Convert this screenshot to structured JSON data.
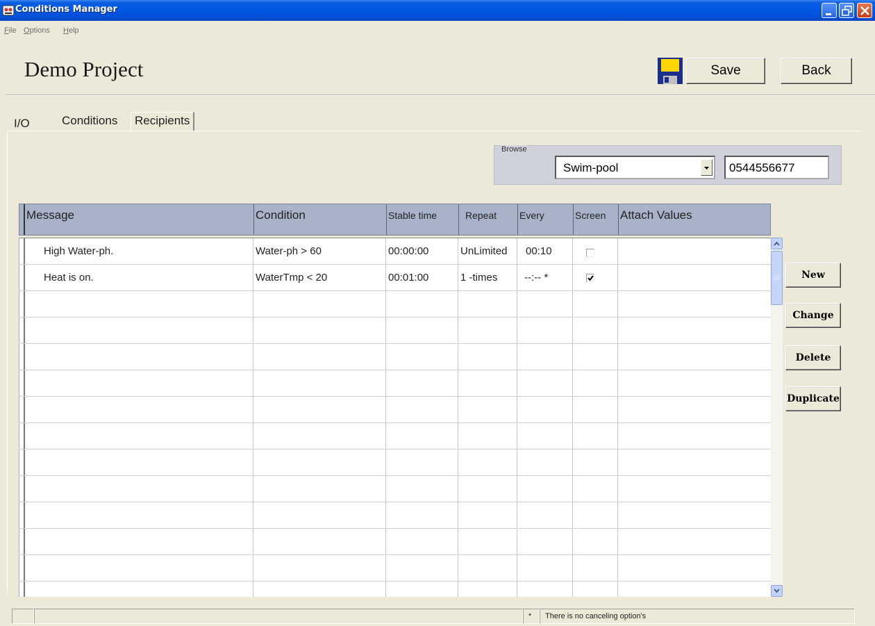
{
  "window": {
    "title": "Conditions Manager"
  },
  "menu": [
    "File",
    "Options",
    "Help"
  ],
  "header": {
    "project_title": "Demo Project",
    "save_label": "Save",
    "back_label": "Back"
  },
  "tabs": [
    {
      "label": "I/O"
    },
    {
      "label": "Conditions",
      "active": true
    },
    {
      "label": "Recipients"
    }
  ],
  "browse": {
    "label": "Browse",
    "selected": "Swim-pool",
    "phone": "0544556677"
  },
  "grid": {
    "columns": [
      "Message",
      "Condition",
      "Stable time",
      "Repeat",
      "Every",
      "Screen",
      "Attach Values"
    ],
    "rows": [
      {
        "message": "High Water-ph.",
        "condition": "Water-ph > 60",
        "stable_time": "00:00:00",
        "repeat": "UnLimited",
        "every": "00:10",
        "screen": false,
        "attach_values": ""
      },
      {
        "message": "Heat is on.",
        "condition": "WaterTmp < 20",
        "stable_time": "00:01:00",
        "repeat": "1 -times",
        "every": "--:-- *",
        "screen": true,
        "attach_values": ""
      }
    ],
    "empty_rows": 11
  },
  "actions": {
    "new": "New",
    "change": "Change",
    "delete": "Delete",
    "duplicate": "Duplicate"
  },
  "status": {
    "marker": "*",
    "note": "There is no canceling option's"
  },
  "colors": {
    "titlebar": "#0058e6",
    "window_bg": "#ece9d8",
    "grid_header": "#a8b3c9",
    "browse_bg": "#cfd2da"
  }
}
